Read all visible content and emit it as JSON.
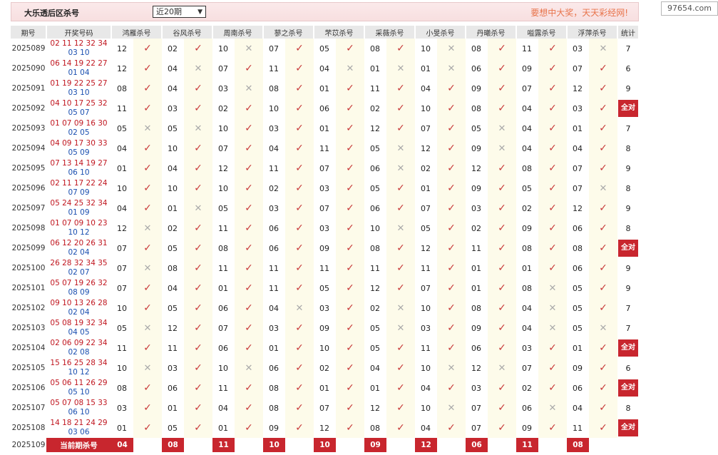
{
  "header": {
    "title": "大乐透后区杀号",
    "select_value": "近20期",
    "slogan": "要想中大奖，天天彩经网!"
  },
  "watermark": "97654.com",
  "columns": [
    "期号",
    "开奖号码",
    "鸿雁杀号",
    "谷风杀号",
    "周南杀号",
    "蓼之杀号",
    "芣苡杀号",
    "采薇杀号",
    "小旻杀号",
    "丹曦杀号",
    "嗌露杀号",
    "浮萍杀号",
    "统计"
  ],
  "all_correct_label": "全对",
  "current_label": "当前期杀号",
  "rows": [
    {
      "p": "2025089",
      "f": "02 11 12 32 34",
      "b": "03 10",
      "k": [
        [
          "12",
          1
        ],
        [
          "02",
          1
        ],
        [
          "10",
          0
        ],
        [
          "07",
          1
        ],
        [
          "05",
          1
        ],
        [
          "08",
          1
        ],
        [
          "10",
          0
        ],
        [
          "08",
          1
        ],
        [
          "11",
          1
        ],
        [
          "03",
          0
        ]
      ],
      "s": "7"
    },
    {
      "p": "2025090",
      "f": "06 14 19 22 27",
      "b": "01 04",
      "k": [
        [
          "12",
          1
        ],
        [
          "04",
          0
        ],
        [
          "07",
          1
        ],
        [
          "11",
          1
        ],
        [
          "04",
          0
        ],
        [
          "01",
          0
        ],
        [
          "01",
          0
        ],
        [
          "06",
          1
        ],
        [
          "09",
          1
        ],
        [
          "07",
          1
        ]
      ],
      "s": "6"
    },
    {
      "p": "2025091",
      "f": "01 19 22 25 27",
      "b": "03 10",
      "k": [
        [
          "08",
          1
        ],
        [
          "04",
          1
        ],
        [
          "03",
          0
        ],
        [
          "08",
          1
        ],
        [
          "01",
          1
        ],
        [
          "11",
          1
        ],
        [
          "04",
          1
        ],
        [
          "09",
          1
        ],
        [
          "07",
          1
        ],
        [
          "12",
          1
        ]
      ],
      "s": "9"
    },
    {
      "p": "2025092",
      "f": "04 10 17 25 32",
      "b": "05 07",
      "k": [
        [
          "11",
          1
        ],
        [
          "03",
          1
        ],
        [
          "02",
          1
        ],
        [
          "10",
          1
        ],
        [
          "06",
          1
        ],
        [
          "02",
          1
        ],
        [
          "10",
          1
        ],
        [
          "08",
          1
        ],
        [
          "04",
          1
        ],
        [
          "03",
          1
        ]
      ],
      "s": "全对"
    },
    {
      "p": "2025093",
      "f": "01 07 09 16 30",
      "b": "02 05",
      "k": [
        [
          "05",
          0
        ],
        [
          "05",
          0
        ],
        [
          "10",
          1
        ],
        [
          "03",
          1
        ],
        [
          "01",
          1
        ],
        [
          "12",
          1
        ],
        [
          "07",
          1
        ],
        [
          "05",
          0
        ],
        [
          "04",
          1
        ],
        [
          "01",
          1
        ]
      ],
      "s": "7"
    },
    {
      "p": "2025094",
      "f": "04 09 17 30 33",
      "b": "05 09",
      "k": [
        [
          "04",
          1
        ],
        [
          "10",
          1
        ],
        [
          "07",
          1
        ],
        [
          "04",
          1
        ],
        [
          "11",
          1
        ],
        [
          "05",
          0
        ],
        [
          "12",
          1
        ],
        [
          "09",
          0
        ],
        [
          "04",
          1
        ],
        [
          "04",
          1
        ]
      ],
      "s": "8"
    },
    {
      "p": "2025095",
      "f": "07 13 14 19 27",
      "b": "06 10",
      "k": [
        [
          "01",
          1
        ],
        [
          "04",
          1
        ],
        [
          "12",
          1
        ],
        [
          "11",
          1
        ],
        [
          "07",
          1
        ],
        [
          "06",
          0
        ],
        [
          "02",
          1
        ],
        [
          "12",
          1
        ],
        [
          "08",
          1
        ],
        [
          "07",
          1
        ]
      ],
      "s": "9"
    },
    {
      "p": "2025096",
      "f": "02 11 17 22 24",
      "b": "07 09",
      "k": [
        [
          "10",
          1
        ],
        [
          "10",
          1
        ],
        [
          "10",
          1
        ],
        [
          "02",
          1
        ],
        [
          "03",
          1
        ],
        [
          "05",
          1
        ],
        [
          "01",
          1
        ],
        [
          "09",
          1
        ],
        [
          "05",
          1
        ],
        [
          "07",
          0
        ]
      ],
      "s": "8"
    },
    {
      "p": "2025097",
      "f": "05 24 25 32 34",
      "b": "01 09",
      "k": [
        [
          "04",
          1
        ],
        [
          "01",
          0
        ],
        [
          "05",
          1
        ],
        [
          "03",
          1
        ],
        [
          "07",
          1
        ],
        [
          "06",
          1
        ],
        [
          "07",
          1
        ],
        [
          "03",
          1
        ],
        [
          "02",
          1
        ],
        [
          "12",
          1
        ]
      ],
      "s": "9"
    },
    {
      "p": "2025098",
      "f": "01 07 09 10 23",
      "b": "10 12",
      "k": [
        [
          "12",
          0
        ],
        [
          "02",
          1
        ],
        [
          "11",
          1
        ],
        [
          "06",
          1
        ],
        [
          "03",
          1
        ],
        [
          "10",
          0
        ],
        [
          "05",
          1
        ],
        [
          "02",
          1
        ],
        [
          "09",
          1
        ],
        [
          "06",
          1
        ]
      ],
      "s": "8"
    },
    {
      "p": "2025099",
      "f": "06 12 20 26 31",
      "b": "02 04",
      "k": [
        [
          "07",
          1
        ],
        [
          "05",
          1
        ],
        [
          "08",
          1
        ],
        [
          "06",
          1
        ],
        [
          "09",
          1
        ],
        [
          "08",
          1
        ],
        [
          "12",
          1
        ],
        [
          "11",
          1
        ],
        [
          "08",
          1
        ],
        [
          "08",
          1
        ]
      ],
      "s": "全对"
    },
    {
      "p": "2025100",
      "f": "26 28 32 34 35",
      "b": "02 07",
      "k": [
        [
          "07",
          0
        ],
        [
          "08",
          1
        ],
        [
          "11",
          1
        ],
        [
          "11",
          1
        ],
        [
          "11",
          1
        ],
        [
          "11",
          1
        ],
        [
          "11",
          1
        ],
        [
          "01",
          1
        ],
        [
          "01",
          1
        ],
        [
          "06",
          1
        ]
      ],
      "s": "9"
    },
    {
      "p": "2025101",
      "f": "05 07 19 26 32",
      "b": "08 09",
      "k": [
        [
          "07",
          1
        ],
        [
          "04",
          1
        ],
        [
          "01",
          1
        ],
        [
          "11",
          1
        ],
        [
          "05",
          1
        ],
        [
          "12",
          1
        ],
        [
          "07",
          1
        ],
        [
          "01",
          1
        ],
        [
          "08",
          0
        ],
        [
          "05",
          1
        ]
      ],
      "s": "9"
    },
    {
      "p": "2025102",
      "f": "09 10 13 26 28",
      "b": "02 04",
      "k": [
        [
          "10",
          1
        ],
        [
          "05",
          1
        ],
        [
          "06",
          1
        ],
        [
          "04",
          0
        ],
        [
          "03",
          1
        ],
        [
          "02",
          0
        ],
        [
          "10",
          1
        ],
        [
          "08",
          1
        ],
        [
          "04",
          0
        ],
        [
          "05",
          1
        ]
      ],
      "s": "7"
    },
    {
      "p": "2025103",
      "f": "05 08 19 32 34",
      "b": "04 05",
      "k": [
        [
          "05",
          0
        ],
        [
          "12",
          1
        ],
        [
          "07",
          1
        ],
        [
          "03",
          1
        ],
        [
          "09",
          1
        ],
        [
          "05",
          0
        ],
        [
          "03",
          1
        ],
        [
          "09",
          1
        ],
        [
          "04",
          0
        ],
        [
          "05",
          0
        ]
      ],
      "s": "7"
    },
    {
      "p": "2025104",
      "f": "02 06 09 22 34",
      "b": "02 08",
      "k": [
        [
          "11",
          1
        ],
        [
          "11",
          1
        ],
        [
          "06",
          1
        ],
        [
          "01",
          1
        ],
        [
          "10",
          1
        ],
        [
          "05",
          1
        ],
        [
          "11",
          1
        ],
        [
          "06",
          1
        ],
        [
          "03",
          1
        ],
        [
          "01",
          1
        ]
      ],
      "s": "全对"
    },
    {
      "p": "2025105",
      "f": "15 16 25 28 34",
      "b": "10 12",
      "k": [
        [
          "10",
          0
        ],
        [
          "03",
          1
        ],
        [
          "10",
          0
        ],
        [
          "06",
          1
        ],
        [
          "02",
          1
        ],
        [
          "04",
          1
        ],
        [
          "10",
          0
        ],
        [
          "12",
          0
        ],
        [
          "07",
          1
        ],
        [
          "09",
          1
        ]
      ],
      "s": "6"
    },
    {
      "p": "2025106",
      "f": "05 06 11 26 29",
      "b": "05 10",
      "k": [
        [
          "08",
          1
        ],
        [
          "06",
          1
        ],
        [
          "11",
          1
        ],
        [
          "08",
          1
        ],
        [
          "01",
          1
        ],
        [
          "01",
          1
        ],
        [
          "04",
          1
        ],
        [
          "03",
          1
        ],
        [
          "02",
          1
        ],
        [
          "06",
          1
        ]
      ],
      "s": "全对"
    },
    {
      "p": "2025107",
      "f": "05 07 08 15 33",
      "b": "06 10",
      "k": [
        [
          "03",
          1
        ],
        [
          "01",
          1
        ],
        [
          "04",
          1
        ],
        [
          "08",
          1
        ],
        [
          "07",
          1
        ],
        [
          "12",
          1
        ],
        [
          "10",
          0
        ],
        [
          "07",
          1
        ],
        [
          "06",
          0
        ],
        [
          "04",
          1
        ]
      ],
      "s": "8"
    },
    {
      "p": "2025108",
      "f": "14 18 21 24 29",
      "b": "03 06",
      "k": [
        [
          "01",
          1
        ],
        [
          "05",
          1
        ],
        [
          "01",
          1
        ],
        [
          "09",
          1
        ],
        [
          "12",
          1
        ],
        [
          "08",
          1
        ],
        [
          "04",
          1
        ],
        [
          "07",
          1
        ],
        [
          "09",
          1
        ],
        [
          "11",
          1
        ]
      ],
      "s": "全对"
    }
  ],
  "current": {
    "p": "2025109",
    "picks": [
      "04",
      "08",
      "11",
      "10",
      "10",
      "09",
      "12",
      "06",
      "11",
      "08"
    ]
  }
}
